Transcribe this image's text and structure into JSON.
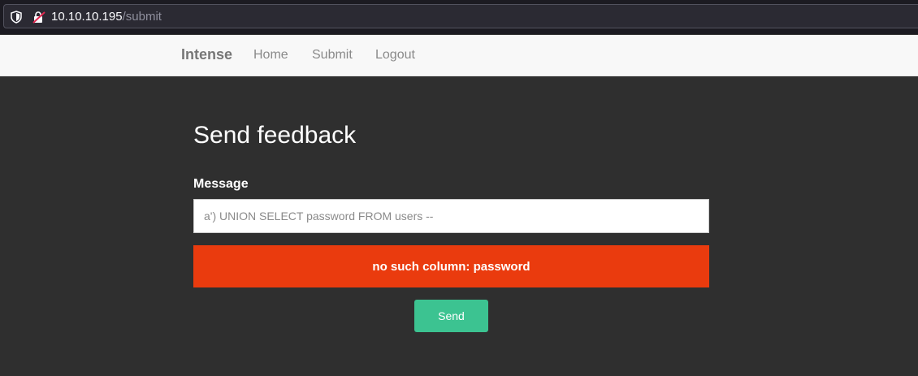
{
  "browser": {
    "url_host": "10.10.10.195",
    "url_path": "/submit",
    "icons": [
      "shield-icon",
      "insecure-lock-icon"
    ]
  },
  "navbar": {
    "brand": "Intense",
    "links": [
      {
        "label": "Home"
      },
      {
        "label": "Submit"
      },
      {
        "label": "Logout"
      }
    ]
  },
  "form": {
    "title": "Send feedback",
    "message_label": "Message",
    "message_value": "a') UNION SELECT password FROM users --",
    "error": "no such column: password",
    "send_label": "Send"
  },
  "colors": {
    "page_background": "#2f2f2f",
    "error_background": "#ea3b0e",
    "send_button": "#3cc391",
    "navbar_background": "#f8f8f8"
  }
}
